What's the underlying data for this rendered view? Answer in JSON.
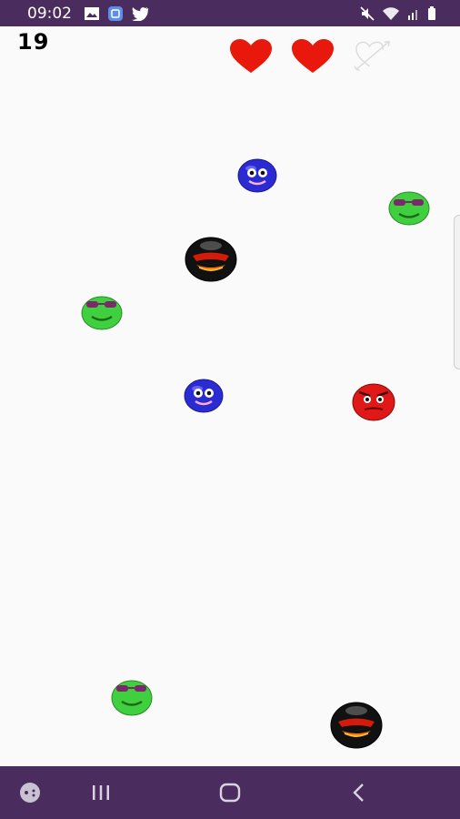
{
  "status_bar": {
    "time": "09:02",
    "left_icons": [
      "image-icon",
      "app-notification-icon",
      "twitter-icon"
    ],
    "right_icons": [
      "mute-icon",
      "wifi-icon",
      "signal-icon",
      "battery-icon"
    ]
  },
  "game": {
    "score": "19",
    "lives": [
      {
        "name": "heart-full-icon",
        "state": "full"
      },
      {
        "name": "heart-full-icon",
        "state": "full"
      },
      {
        "name": "heart-arrow-outline-icon",
        "state": "lost"
      }
    ],
    "balls": [
      {
        "type": "blue-smiley-ball",
        "color": "#2a2ad6"
      },
      {
        "type": "green-sunglasses-ball",
        "color": "#3fcf3f"
      },
      {
        "type": "black-angry-bomb-ball",
        "color": "#111111"
      },
      {
        "type": "green-sunglasses-ball",
        "color": "#3fcf3f"
      },
      {
        "type": "blue-smiley-ball",
        "color": "#2a2ad6"
      },
      {
        "type": "red-angry-ball",
        "color": "#e01818"
      },
      {
        "type": "green-sunglasses-ball",
        "color": "#3fcf3f"
      },
      {
        "type": "black-angry-bomb-ball",
        "color": "#111111"
      }
    ]
  },
  "nav_bar": {
    "buttons": [
      "game-launcher-icon",
      "recent-apps-icon",
      "home-icon",
      "back-icon"
    ]
  },
  "colors": {
    "status_bar": "#4a2d5e",
    "background": "#fafafa",
    "heart": "#e8180c"
  }
}
